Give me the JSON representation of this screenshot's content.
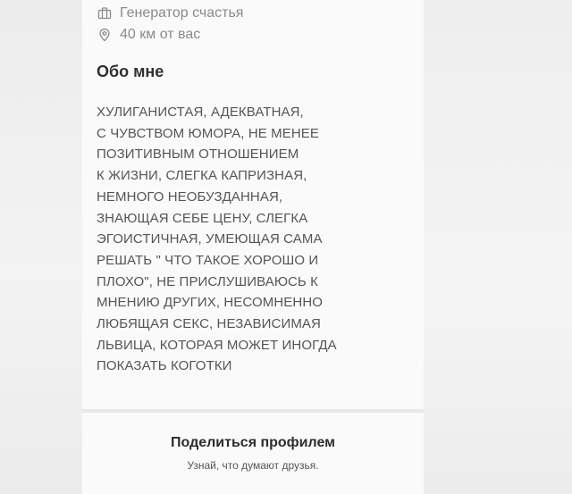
{
  "profile": {
    "work": "Генератор счастья",
    "work_icon": "briefcase-icon",
    "distance": "40 км от вас",
    "distance_icon": "location-pin-icon"
  },
  "about": {
    "title": "Обо мне",
    "lines": [
      "ХУЛИГАНИСТАЯ, АДЕКВАТНАЯ,",
      "С ЧУВСТВОМ ЮМОРА, НЕ МЕНЕЕ",
      "ПОЗИТИВНЫМ ОТНОШЕНИЕМ",
      "К ЖИЗНИ, СЛЕГКА КАПРИЗНАЯ,",
      "НЕМНОГО НЕОБУЗДАННАЯ,",
      "ЗНАЮЩАЯ СЕБЕ ЦЕНУ, СЛЕГКА",
      "ЭГОИСТИЧНАЯ, УМЕЮЩАЯ САМА",
      "РЕШАТЬ \" ЧТО ТАКОЕ ХОРОШО И",
      "ПЛОХО\", НЕ ПРИСЛУШИВАЮСЬ К",
      "МНЕНИЮ ДРУГИХ, НЕСОМНЕННО",
      "ЛЮБЯЩАЯ СЕКС, НЕЗАВИСИМАЯ",
      "ЛЬВИЦА, КОТОРАЯ МОЖЕТ ИНОГДА",
      "ПОКАЗАТЬ КОГОТКИ"
    ]
  },
  "share": {
    "title": "Поделиться профилем",
    "subtitle": "Узнай, что думают друзья."
  },
  "colors": {
    "card_background": "#fafafa",
    "page_background": "#f0f0f0",
    "text_primary": "#2f2f2f",
    "text_secondary": "#8a8a8a",
    "text_body": "#555555"
  }
}
